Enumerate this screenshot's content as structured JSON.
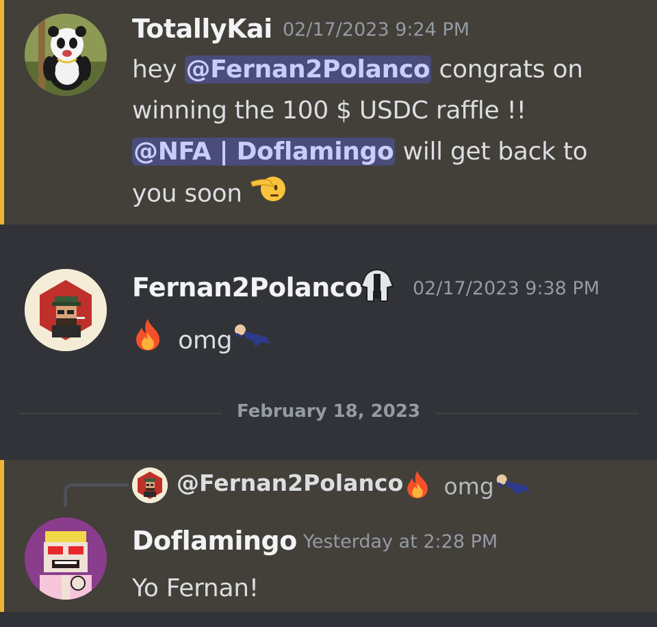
{
  "messages": [
    {
      "username": "TotallyKai",
      "timestamp": "02/17/2023 9:24 PM",
      "text_1": "hey ",
      "mention_1": "@Fernan2Polanco",
      "text_2": " congrats on winning the 100 $ USDC raffle !!",
      "mention_2": "@NFA | Doflamingo",
      "text_3": " will get back to you soon",
      "emoji": "saluting-face"
    },
    {
      "username": "Fernan2Polanco",
      "badge": "server-badge-icon",
      "timestamp": "02/17/2023 9:38 PM",
      "emoji_1": "fire",
      "text": "omg",
      "emoji_2": "sleeping-person-sticker"
    },
    {
      "username": "Doflamingo",
      "timestamp": "Yesterday at 2:28 PM",
      "reply": {
        "username": "@Fernan2Polanco",
        "text": "omg"
      },
      "text": "Yo Fernan!"
    }
  ],
  "date_divider": "February 18, 2023",
  "colors": {
    "highlight_bg": "#433f39",
    "highlight_bar": "#f0b232",
    "mention_bg": "#5865f2",
    "background": "#313338"
  }
}
